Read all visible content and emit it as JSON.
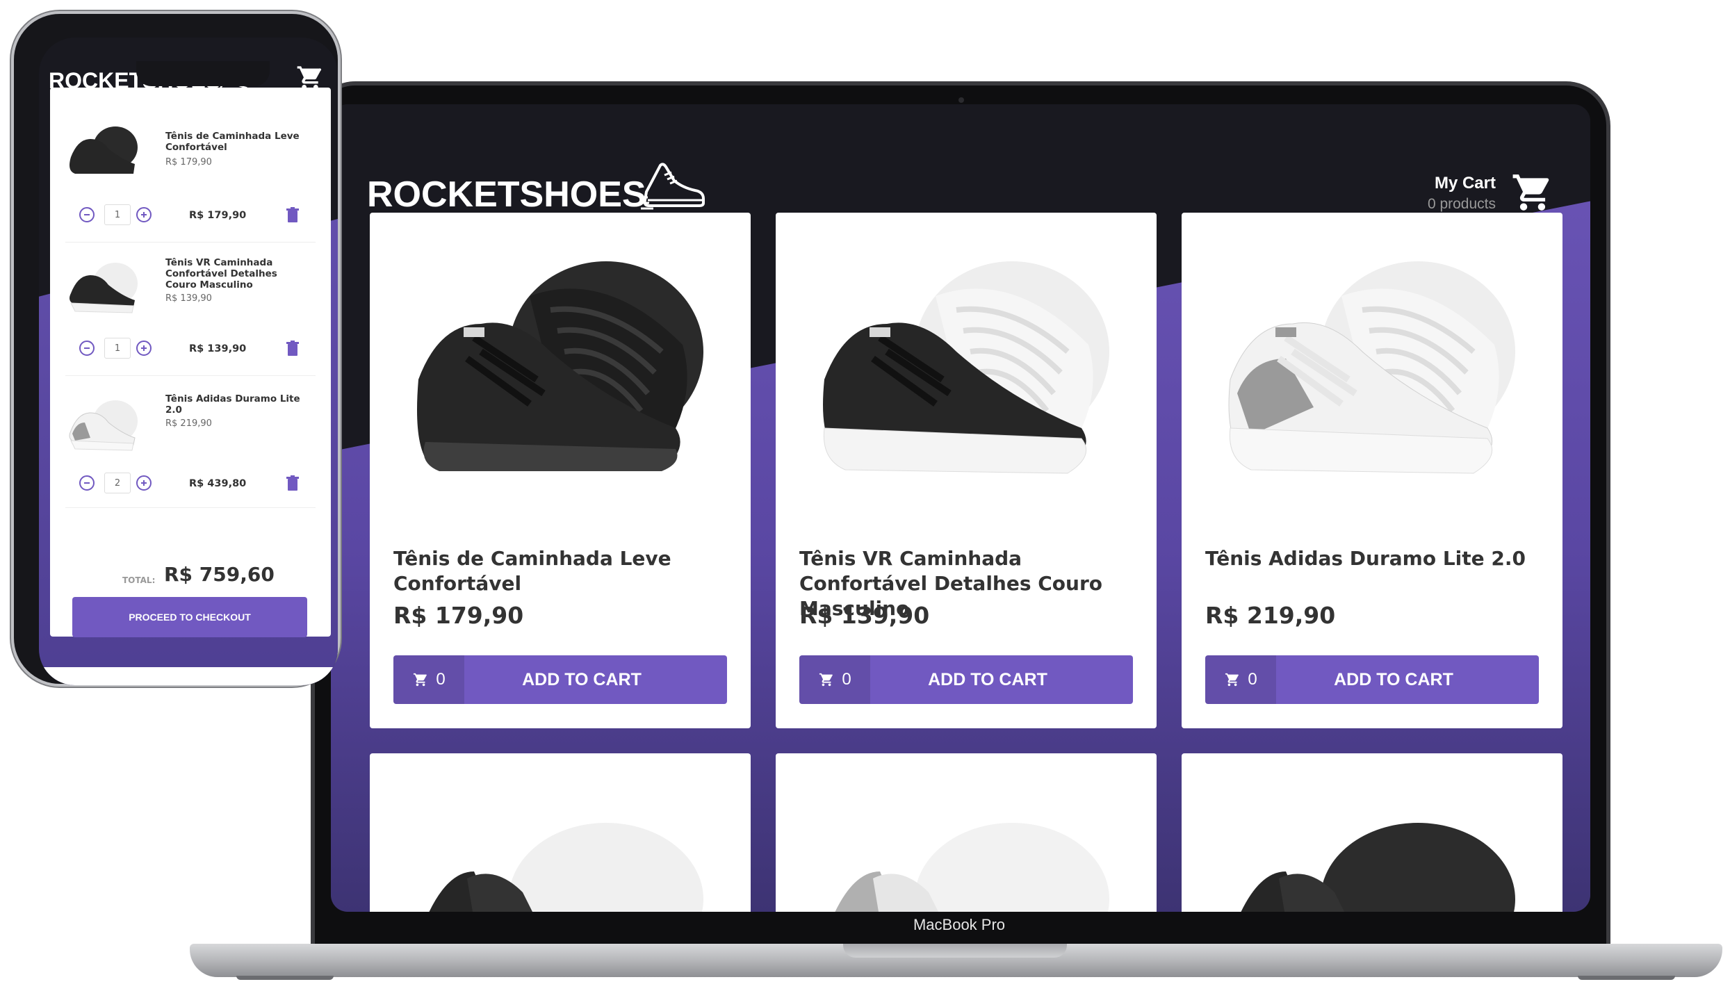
{
  "laptop": {
    "label": "MacBook Pro"
  },
  "shop": {
    "logo": "ROCKETSHOES",
    "cart": {
      "title": "My Cart",
      "count_text": "0 products"
    },
    "products": [
      {
        "title": "Tênis de Caminhada Leve Confortável",
        "price": "R$ 179,90",
        "cart_amount": "0",
        "button_label": "ADD TO CART",
        "shoe_color": "black"
      },
      {
        "title": "Tênis VR Caminhada Confortável Detalhes Couro Masculino",
        "price": "R$ 139,90",
        "cart_amount": "0",
        "button_label": "ADD TO CART",
        "shoe_color": "black-white"
      },
      {
        "title": "Tênis Adidas Duramo Lite 2.0",
        "price": "R$ 219,90",
        "cart_amount": "0",
        "button_label": "ADD TO CART",
        "shoe_color": "white-grey"
      }
    ]
  },
  "phone": {
    "logo": "ROCKETSHOES",
    "cart_items": [
      {
        "title": "Tênis de Caminhada Leve Confortável",
        "price": "R$ 179,90",
        "quantity": "1",
        "subtotal": "R$ 179,90"
      },
      {
        "title": "Tênis VR Caminhada Confortável Detalhes Couro Masculino",
        "price": "R$ 139,90",
        "quantity": "1",
        "subtotal": "R$ 139,90"
      },
      {
        "title": "Tênis Adidas Duramo Lite 2.0",
        "price": "R$ 219,90",
        "quantity": "2",
        "subtotal": "R$ 439,80"
      }
    ],
    "total_label": "TOTAL:",
    "total_value": "R$ 759,60",
    "checkout_label": "PROCEED TO CHECKOUT"
  },
  "colors": {
    "accent": "#7159c1",
    "header_bg": "#191920"
  }
}
